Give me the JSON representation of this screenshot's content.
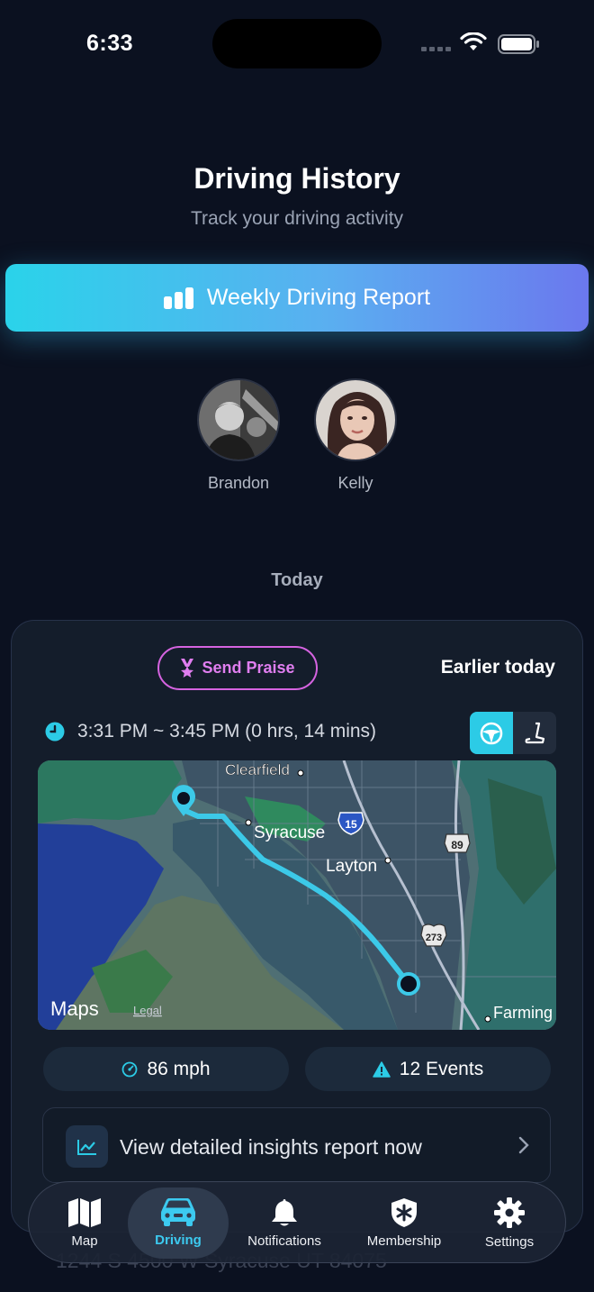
{
  "status_bar": {
    "time": "6:33"
  },
  "header": {
    "title": "Driving History",
    "subtitle": "Track your driving activity"
  },
  "report_button": {
    "label": "Weekly Driving Report",
    "icon": "bar-chart-icon"
  },
  "people": [
    {
      "name": "Brandon"
    },
    {
      "name": "Kelly"
    }
  ],
  "section_label": "Today",
  "trip": {
    "praise_label": "Send Praise",
    "when": "Earlier today",
    "time_range": "3:31 PM ~ 3:45 PM (0 hrs, 14 mins)",
    "map": {
      "places": [
        "Clearfield",
        "Syracuse",
        "Layton",
        "Farming"
      ],
      "shields": [
        "15",
        "89",
        "273"
      ],
      "brand": "Maps",
      "legal": "Legal"
    },
    "speed": "86 mph",
    "events": "12 Events",
    "insights_label": "View detailed insights report now"
  },
  "ghost_address": "1244 S 4500 W Syracuse UT 84075",
  "tabs": [
    {
      "label": "Map",
      "icon": "map-icon"
    },
    {
      "label": "Driving",
      "icon": "car-icon",
      "active": true
    },
    {
      "label": "Notifications",
      "icon": "bell-icon"
    },
    {
      "label": "Membership",
      "icon": "shield-icon"
    },
    {
      "label": "Settings",
      "icon": "gear-icon"
    }
  ],
  "colors": {
    "accent": "#2ccbe6",
    "praise": "#d563e0",
    "background": "#0b1120"
  }
}
